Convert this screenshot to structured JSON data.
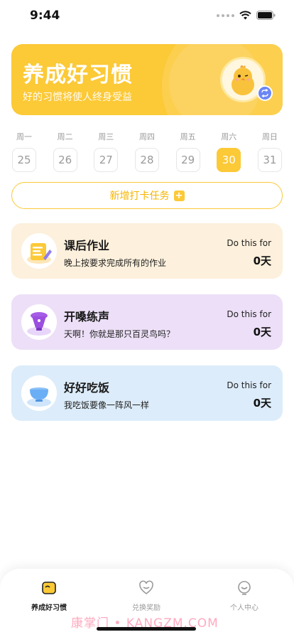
{
  "status_bar": {
    "time": "9:44"
  },
  "banner": {
    "title": "养成好习惯",
    "subtitle": "好的习惯将使人终身受益",
    "avatar_icon": "chick-avatar",
    "swap_icon": "swap-icon"
  },
  "week": [
    {
      "name": "周一",
      "date": "25",
      "active": false
    },
    {
      "name": "周二",
      "date": "26",
      "active": false
    },
    {
      "name": "周三",
      "date": "27",
      "active": false
    },
    {
      "name": "周四",
      "date": "28",
      "active": false
    },
    {
      "name": "周五",
      "date": "29",
      "active": false
    },
    {
      "name": "周六",
      "date": "30",
      "active": true
    },
    {
      "name": "周日",
      "date": "31",
      "active": false
    }
  ],
  "add_task": {
    "label": "新增打卡任务"
  },
  "habits": [
    {
      "title": "课后作业",
      "desc": "晚上按要求完成所有的作业",
      "do_this": "Do this for",
      "count": "0天",
      "icon": "homework-icon",
      "bg": "#fdf0dc"
    },
    {
      "title": "开嗓练声",
      "desc": "天啊！你就是那只百灵鸟吗？",
      "do_this": "Do this for",
      "count": "0天",
      "icon": "microphone-icon",
      "bg": "#ecdff7"
    },
    {
      "title": "好好吃饭",
      "desc": "我吃饭要像一阵风一样",
      "do_this": "Do this for",
      "count": "0天",
      "icon": "bowl-icon",
      "bg": "#dcecfa"
    }
  ],
  "tabs": [
    {
      "label": "养成好习惯",
      "icon": "habit-tab-icon",
      "active": true
    },
    {
      "label": "兑换奖励",
      "icon": "reward-tab-icon",
      "active": false
    },
    {
      "label": "个人中心",
      "icon": "profile-tab-icon",
      "active": false
    }
  ],
  "watermark": "康掌门 • KANGZM.COM",
  "colors": {
    "accent": "#fcc937",
    "accent_text": "#f6b500"
  }
}
